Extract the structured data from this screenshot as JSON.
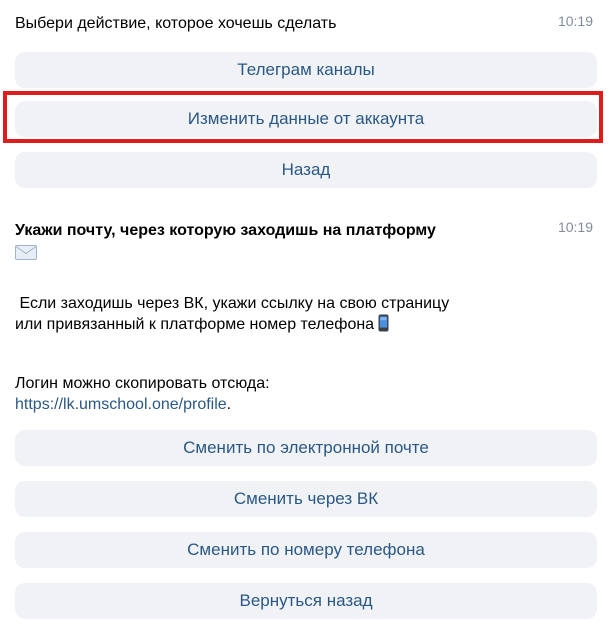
{
  "message1": {
    "text": "Выбери действие, которое хочешь сделать",
    "time": "10:19",
    "buttons": [
      "Телеграм каналы",
      "Изменить данные от аккаунта",
      "Назад"
    ]
  },
  "message2": {
    "title": "Укажи почту, через которую заходишь на платформу",
    "time": "10:19",
    "paragraph1_line1": "Если заходишь через ВК, укажи ссылку на свою страницу",
    "paragraph1_line2": "или привязанный к платформе номер телефона",
    "paragraph2_line1": "Логин можно скопировать отсюда:",
    "link": "https://lk.umschool.one/profile",
    "link_suffix": ".",
    "buttons": [
      "Сменить по электронной почте",
      "Сменить через ВК",
      "Сменить по номеру телефона",
      "Вернуться назад"
    ]
  },
  "icons": {
    "envelope": "envelope-icon",
    "phone": "mobile-phone-icon"
  },
  "colors": {
    "button_bg": "#f0f2f5",
    "button_text": "#2a5885",
    "link": "#2a5885",
    "time": "#818c99",
    "highlight": "#e01b1b"
  }
}
